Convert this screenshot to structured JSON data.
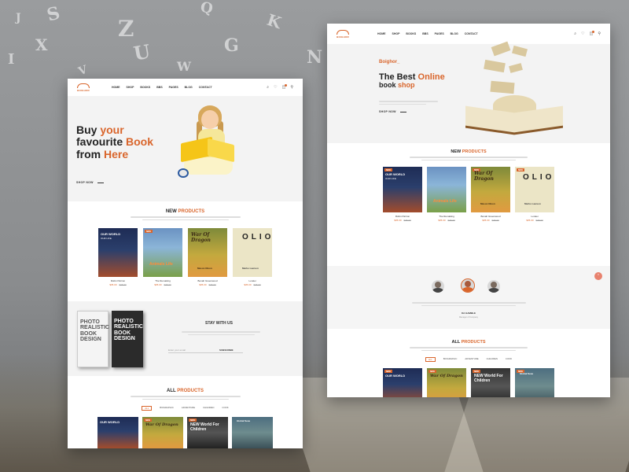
{
  "nav": {
    "logo": "BOIGHOR",
    "items": [
      "HOME",
      "SHOP",
      "BOOKS",
      "BBS",
      "PAGES",
      "BLOG",
      "CONTACT"
    ]
  },
  "left": {
    "hero": {
      "line1_a": "Buy ",
      "line1_b": "your",
      "line2_a": "favourite ",
      "line2_b": "Book",
      "line3_a": "from ",
      "line3_b": "Here",
      "cta": "SHOP NOW"
    },
    "new_products": {
      "title_a": "NEW ",
      "title_b": "PRODUCTS",
      "items": [
        {
          "name": "Robin Parrion",
          "price": "$35.00",
          "old": "$35.00",
          "cover_title": "OUR WORLD",
          "cover_sub": "OUR LIFE"
        },
        {
          "name": "The Remaking",
          "price": "$35.00",
          "old": "$35.00",
          "cover_title": "Animals Life",
          "cover_sub": ""
        },
        {
          "name": "Bonah Greenwood",
          "price": "$35.00",
          "old": "$35.00",
          "cover_title": "War Of Dragon",
          "cover_sub": "Mason Nixon"
        },
        {
          "name": "Lorelei",
          "price": "$35.00",
          "old": "$35.00",
          "cover_title": "OLIO",
          "cover_sub": "Marko Lawson"
        }
      ]
    },
    "stay": {
      "title": "STAY WITH US",
      "placeholder": "Enter your email",
      "button": "SUBSCRIBE",
      "book_white": "PHOTO REALISTIC BOOK DESIGN",
      "book_black": "PHOTO REALISTIC BOOK DESIGN"
    },
    "all_products": {
      "title_a": "ALL ",
      "title_b": "PRODUCTS",
      "tabs": [
        "ALL",
        "BIOGRAPHIC",
        "ADVENTURE",
        "CHILDREN",
        "COOK"
      ],
      "covers": [
        "OUR WORLD",
        "War Of Dragon",
        "NEW World For Children",
        "Global Seas"
      ]
    }
  },
  "right": {
    "hero": {
      "brand": "Boighor_",
      "line1_a": "The Best ",
      "line1_b": "Online",
      "line2_a": "book ",
      "line2_b": "shop",
      "cta": "SHOP NOW"
    },
    "new_products": {
      "title_a": "NEW ",
      "title_b": "PRODUCTS",
      "items": [
        {
          "name": "Robin Parrion",
          "price": "$35.00",
          "old": "$35.00",
          "cover_title": "OUR WORLD",
          "cover_sub": "OUR LIFE"
        },
        {
          "name": "The Remaking",
          "price": "$35.00",
          "old": "$35.00",
          "cover_title": "Animals Life",
          "cover_sub": ""
        },
        {
          "name": "Bonah Greenwood",
          "price": "$35.00",
          "old": "$35.00",
          "cover_title": "War Of Dragon",
          "cover_sub": "Mason Nixon"
        },
        {
          "name": "Lorelei",
          "price": "$35.00",
          "old": "$35.00",
          "cover_title": "OLIO",
          "cover_sub": "Marko Lawson"
        }
      ]
    },
    "testimonial": {
      "name": "KA GAMBLE",
      "role": "Manager of Company"
    },
    "all_products": {
      "title_a": "ALL ",
      "title_b": "PRODUCTS",
      "tabs": [
        "ALL",
        "BIOGRAPHIC",
        "ADVENTURE",
        "CHILDREN",
        "COOK"
      ],
      "covers": [
        "OUR WORLD",
        "War Of Dragon",
        "NEW World For Children",
        "Global Seas"
      ]
    }
  },
  "colors": {
    "accent": "#d9652b"
  }
}
